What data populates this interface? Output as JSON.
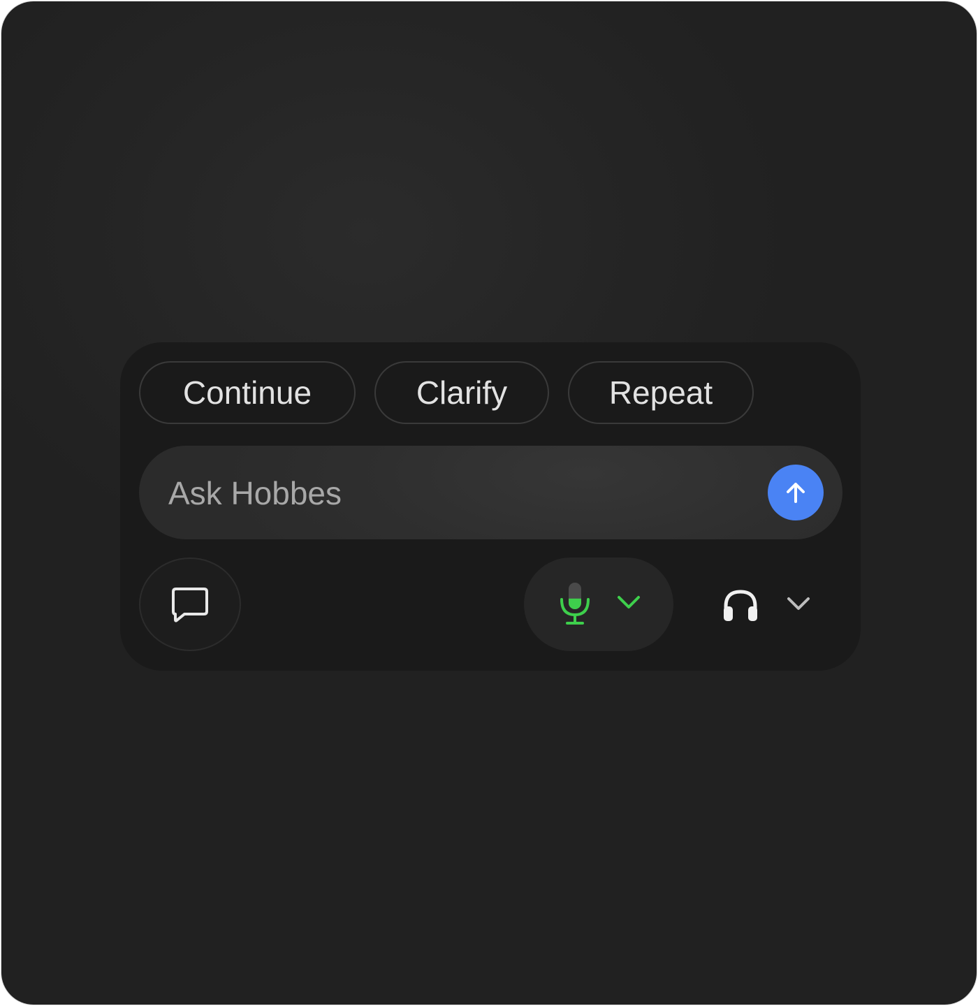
{
  "quick_replies": {
    "continue_label": "Continue",
    "clarify_label": "Clarify",
    "repeat_label": "Repeat"
  },
  "ask": {
    "placeholder": "Ask Hobbes",
    "value": ""
  },
  "icons": {
    "send": "arrow-up-icon",
    "chat": "chat-bubble-icon",
    "mic": "microphone-icon",
    "mic_dropdown": "chevron-down-icon",
    "audio": "headphones-icon",
    "audio_dropdown": "chevron-down-icon"
  },
  "mic": {
    "input_level": 0.4
  },
  "colors": {
    "accent_blue": "#4a83f4",
    "mic_active_green": "#3ecf4c",
    "background": "#212121",
    "panel": "#1a1a1a"
  }
}
